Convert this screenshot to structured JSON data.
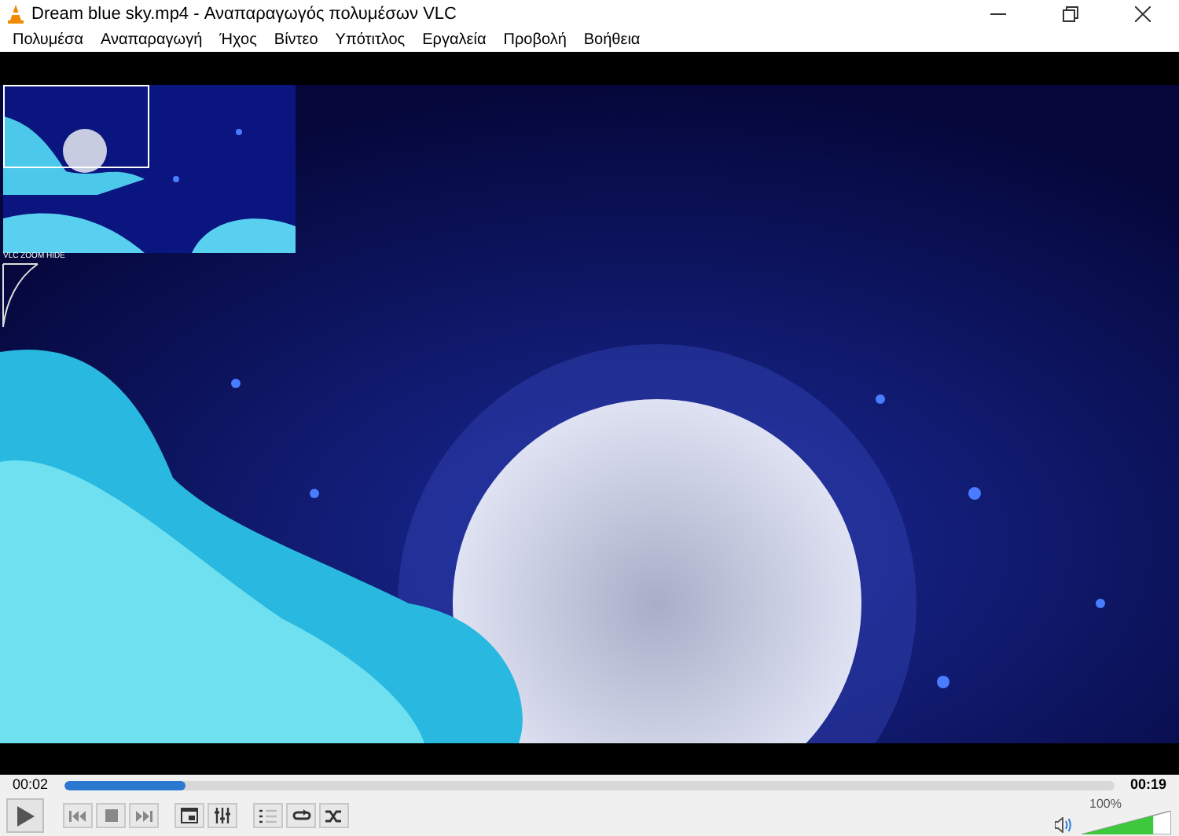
{
  "window": {
    "title": "Dream blue sky.mp4 - Αναπαραγωγός πολυμέσων VLC"
  },
  "menu": [
    "Πολυμέσα",
    "Αναπαραγωγή",
    "Ήχος",
    "Βίντεο",
    "Υπότιτλος",
    "Εργαλεία",
    "Προβολή",
    "Βοήθεια"
  ],
  "zoom_overlay": {
    "label": "VLC ZOOM HIDE"
  },
  "seek": {
    "elapsed": "00:02",
    "total": "00:19",
    "level": 0.115
  },
  "volume": {
    "reading": "100%",
    "level": 0.8
  }
}
